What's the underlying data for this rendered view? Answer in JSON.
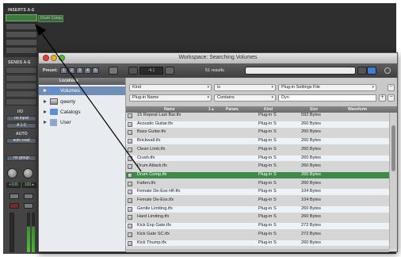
{
  "mixer": {
    "inserts_label": "INSERTS A-E",
    "dragged_plugin": "Drum Comp.tfx",
    "sends_label": "SENDS A-E",
    "io_label": "I/O",
    "input_value": "no input",
    "output_value": "A 1-2",
    "auto_label": "AUTO",
    "auto_value": "auto read",
    "group_value": "no group",
    "level_left": "+100",
    "level_right": "100 ▸"
  },
  "window": {
    "title": "Workspace: Searching Volumes",
    "preset_label": "Preset:",
    "presets": [
      "1",
      "2",
      "3",
      "4",
      "5"
    ],
    "counter": "-4.1",
    "results": "51 results"
  },
  "sidebar": {
    "header": "Locations",
    "items": [
      {
        "label": "Volumes",
        "icon": "folder-icon",
        "selected": true
      },
      {
        "label": "qwerty",
        "icon": "hard-drive-icon",
        "selected": false
      },
      {
        "label": "Catalogs",
        "icon": "catalog-folder-icon",
        "selected": false
      },
      {
        "label": "User",
        "icon": "user-folder-icon",
        "selected": false
      }
    ]
  },
  "filters": {
    "row1": {
      "field": "Kind",
      "op": "is",
      "value": "Plug-in Settings File"
    },
    "row2": {
      "field": "Plug-in Name",
      "op": "Contains",
      "value": "Dyn"
    }
  },
  "columns": {
    "name": "Name",
    "sort": "1 ▴",
    "param": "Param.",
    "kind": "Kind",
    "size": "Size",
    "waveform": "Waveform"
  },
  "files": [
    {
      "name": "15 Repeat Last Bar.tfx",
      "kind": "Plug-in S",
      "size": "592 Bytes"
    },
    {
      "name": "Acoustic Guitar.tfx",
      "kind": "Plug-in S",
      "size": "260 Bytes"
    },
    {
      "name": "Bass Guitar.tfx",
      "kind": "Plug-in S",
      "size": "260 Bytes"
    },
    {
      "name": "Brickwall.tfx",
      "kind": "Plug-in S",
      "size": "260 Bytes"
    },
    {
      "name": "Clean Limit.tfx",
      "kind": "Plug-in S",
      "size": "260 Bytes"
    },
    {
      "name": "Crush.tfx",
      "kind": "Plug-in S",
      "size": "260 Bytes"
    },
    {
      "name": "Drum Attack.tfx",
      "kind": "Plug-in S",
      "size": "260 Bytes"
    },
    {
      "name": "Drum Comp.tfx",
      "kind": "Plug-in S",
      "size": "260 Bytes",
      "selected": true
    },
    {
      "name": "Fatten.tfx",
      "kind": "Plug-in S",
      "size": "260 Bytes"
    },
    {
      "name": "Female De-Ess HF.tfx",
      "kind": "Plug-in S",
      "size": "104 Bytes"
    },
    {
      "name": "Female De-Ess.tfx",
      "kind": "Plug-in S",
      "size": "104 Bytes"
    },
    {
      "name": "Gentle Limiting.tfx",
      "kind": "Plug-in S",
      "size": "260 Bytes"
    },
    {
      "name": "Hard Limiting.tfx",
      "kind": "Plug-in S",
      "size": "260 Bytes"
    },
    {
      "name": "Kick Exp Gate.tfx",
      "kind": "Plug-in S",
      "size": "272 Bytes"
    },
    {
      "name": "Kick Gate SC.tfx",
      "kind": "Plug-in S",
      "size": "272 Bytes"
    },
    {
      "name": "Kick Thump.tfx",
      "kind": "Plug-in S",
      "size": "260 Bytes"
    }
  ],
  "colors": {
    "selection_green": "#3e8a49",
    "sidebar_selection": "#6f8fb8",
    "close": "#e0443a",
    "minimize": "#e6b02e",
    "zoom": "#5bb543"
  }
}
